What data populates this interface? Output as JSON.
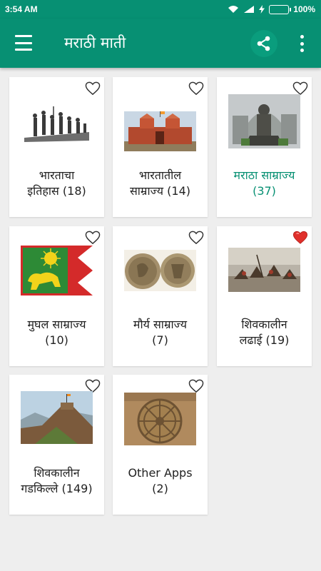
{
  "status_bar": {
    "time": "3:54 AM",
    "battery": "100%",
    "battery_level": 1.0
  },
  "app_bar": {
    "title": "मराठी माती"
  },
  "colors": {
    "primary": "#079073",
    "accent_text": "#079073",
    "favorite": "#e0302b"
  },
  "categories": [
    {
      "line1": "भारताचा",
      "line2": "इतिहास (18)",
      "favorite": false,
      "highlight": false,
      "image": "freedom-march-statue"
    },
    {
      "line1": "भारतातील",
      "line2": "साम्राज्य (14)",
      "favorite": false,
      "highlight": false,
      "image": "red-fort"
    },
    {
      "line1": "मराठा साम्राज्य",
      "line2": "(37)",
      "favorite": false,
      "highlight": true,
      "image": "shivaji-statue"
    },
    {
      "line1": "मुघल साम्राज्य",
      "line2": "(10)",
      "favorite": false,
      "highlight": false,
      "image": "mughal-flag"
    },
    {
      "line1": "मौर्य साम्राज्य",
      "line2": "(7)",
      "favorite": false,
      "highlight": false,
      "image": "maurya-coins"
    },
    {
      "line1": "शिवकालीन",
      "line2": "लढाई (19)",
      "favorite": true,
      "highlight": false,
      "image": "battle-painting"
    },
    {
      "line1": "शिवकालीन",
      "line2": "गडकिल्ले (149)",
      "favorite": false,
      "highlight": false,
      "image": "hill-fort"
    },
    {
      "line1": "Other Apps",
      "line2": "(2)",
      "favorite": false,
      "highlight": false,
      "image": "konark-wheel"
    }
  ]
}
